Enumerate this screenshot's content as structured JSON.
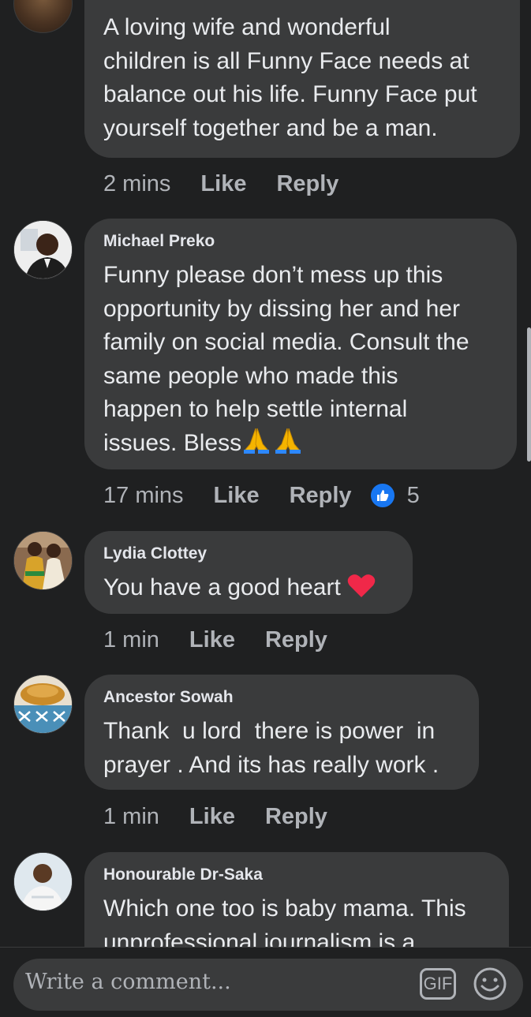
{
  "comments": [
    {
      "author": "",
      "text": "A loving wife and wonderful\nchildren is all Funny Face needs at\nbalance out his life. Funny Face put\nyourself together and be a man.",
      "time": "2 mins",
      "like_label": "Like",
      "reply_label": "Reply"
    },
    {
      "author": "Michael Preko",
      "text": "Funny please don’t mess up this\nopportunity by dissing her and her\nfamily on social media. Consult the\nsame people who made this\nhappen to help settle internal\nissues. Bless",
      "emoji": "🙏🙏",
      "time": "17 mins",
      "like_label": "Like",
      "reply_label": "Reply",
      "reaction_count": "5"
    },
    {
      "author": "Lydia Clottey",
      "text": "You have a good heart",
      "time": "1 min",
      "like_label": "Like",
      "reply_label": "Reply"
    },
    {
      "author": "Ancestor Sowah",
      "text": "Thank  u lord  there is power  in\nprayer . And its has really work .",
      "time": "1 min",
      "like_label": "Like",
      "reply_label": "Reply"
    },
    {
      "author": "Honourable Dr-Saka",
      "text": "Which one too is baby mama. This\nunprofessional journalism is a"
    }
  ],
  "composer": {
    "placeholder": "Write a comment...",
    "gif_label": "GIF"
  },
  "colors": {
    "background": "#1f2021",
    "bubble": "#3a3b3c",
    "like_blue": "#1877f2",
    "heart_red": "#f02849",
    "secondary_text": "#b0b3b8"
  },
  "icons": [
    "pray-emoji-icon",
    "heart-emoji-icon",
    "like-reaction-icon",
    "gif-icon",
    "smiley-icon"
  ]
}
